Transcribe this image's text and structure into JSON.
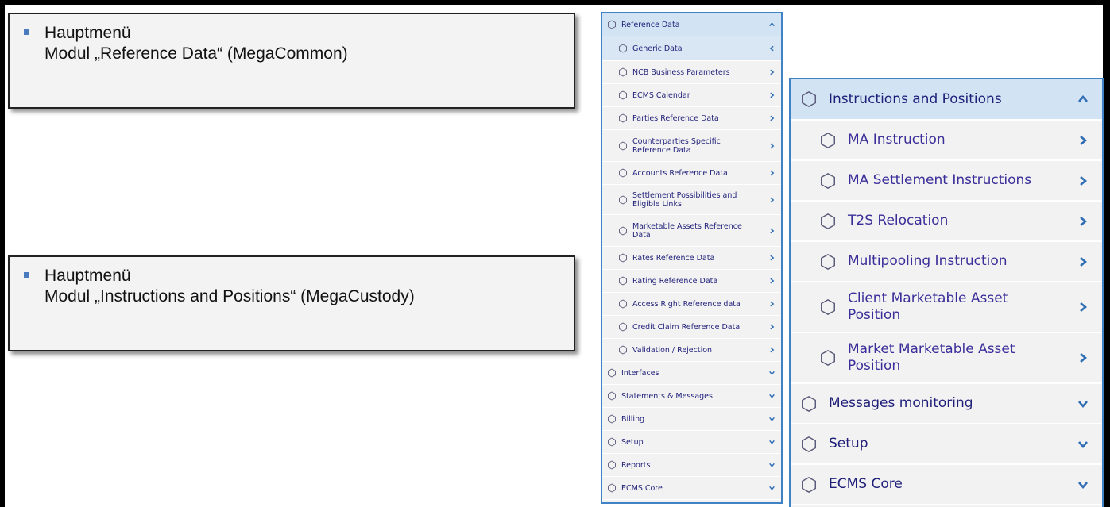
{
  "callouts": [
    {
      "line1": "Hauptmenü",
      "line2": "Modul „Reference Data“ (MegaCommon)"
    },
    {
      "line1": "Hauptmenü",
      "line2": "Modul „Instructions and Positions“ (MegaCustody)"
    }
  ],
  "menu_reference": {
    "header": {
      "label": "Reference Data",
      "icon": "hexagon-icon",
      "chevron": "chevron-up-icon"
    },
    "sub_items": [
      {
        "label": "Generic Data",
        "icon": "hexagon-icon",
        "chevron": "chevron-left-icon",
        "active": true
      },
      {
        "label": "NCB Business Parameters",
        "icon": "hexagon-icon",
        "chevron": "chevron-right-icon"
      },
      {
        "label": "ECMS Calendar",
        "icon": "hexagon-icon",
        "chevron": "chevron-right-icon"
      },
      {
        "label": "Parties Reference Data",
        "icon": "hexagon-icon",
        "chevron": "chevron-right-icon"
      },
      {
        "label": "Counterparties Specific Reference Data",
        "icon": "hexagon-icon",
        "chevron": "chevron-right-icon"
      },
      {
        "label": "Accounts Reference Data",
        "icon": "hexagon-icon",
        "chevron": "chevron-right-icon"
      },
      {
        "label": "Settlement Possibilities and Eligible Links",
        "icon": "hexagon-icon",
        "chevron": "chevron-right-icon"
      },
      {
        "label": "Marketable Assets Reference Data",
        "icon": "hexagon-icon",
        "chevron": "chevron-right-icon"
      },
      {
        "label": "Rates Reference Data",
        "icon": "hexagon-icon",
        "chevron": "chevron-right-icon"
      },
      {
        "label": "Rating Reference Data",
        "icon": "hexagon-icon",
        "chevron": "chevron-right-icon"
      },
      {
        "label": "Access Right Reference data",
        "icon": "hexagon-icon",
        "chevron": "chevron-right-icon"
      },
      {
        "label": "Credit Claim Reference Data",
        "icon": "hexagon-icon",
        "chevron": "chevron-right-icon"
      },
      {
        "label": "Validation / Rejection",
        "icon": "hexagon-icon",
        "chevron": "chevron-right-icon"
      }
    ],
    "top_items": [
      {
        "label": "Interfaces",
        "icon": "hexagon-icon",
        "chevron": "chevron-down-icon"
      },
      {
        "label": "Statements & Messages",
        "icon": "hexagon-icon",
        "chevron": "chevron-down-icon"
      },
      {
        "label": "Billing",
        "icon": "hexagon-icon",
        "chevron": "chevron-down-icon"
      },
      {
        "label": "Setup",
        "icon": "hexagon-icon",
        "chevron": "chevron-down-icon"
      },
      {
        "label": "Reports",
        "icon": "hexagon-icon",
        "chevron": "chevron-down-icon"
      },
      {
        "label": "ECMS Core",
        "icon": "hexagon-icon",
        "chevron": "chevron-down-icon"
      }
    ]
  },
  "menu_instructions": {
    "header": {
      "label": "Instructions and Positions",
      "icon": "hexagon-icon",
      "chevron": "chevron-up-icon"
    },
    "sub_items": [
      {
        "label": "MA Instruction",
        "icon": "hexagon-icon",
        "chevron": "chevron-right-icon"
      },
      {
        "label": "MA Settlement Instructions",
        "icon": "hexagon-icon",
        "chevron": "chevron-right-icon"
      },
      {
        "label": "T2S Relocation",
        "icon": "hexagon-icon",
        "chevron": "chevron-right-icon"
      },
      {
        "label": "Multipooling Instruction",
        "icon": "hexagon-icon",
        "chevron": "chevron-right-icon"
      },
      {
        "label": "Client Marketable Asset Position",
        "icon": "hexagon-icon",
        "chevron": "chevron-right-icon"
      },
      {
        "label": "Market Marketable Asset Position",
        "icon": "hexagon-icon",
        "chevron": "chevron-right-icon"
      }
    ],
    "top_items": [
      {
        "label": "Messages monitoring",
        "icon": "hexagon-icon",
        "chevron": "chevron-down-icon"
      },
      {
        "label": "Setup",
        "icon": "hexagon-icon",
        "chevron": "chevron-down-icon"
      },
      {
        "label": "ECMS Core",
        "icon": "hexagon-icon",
        "chevron": "chevron-down-icon"
      }
    ]
  },
  "colors": {
    "menu_border": "#3f83c6",
    "menu_text": "#1f1f7a",
    "chevron": "#2f6db5",
    "header_bg": "#d2e3f3",
    "item_bg": "#f2f2f2",
    "bullet": "#4a7bbf"
  }
}
